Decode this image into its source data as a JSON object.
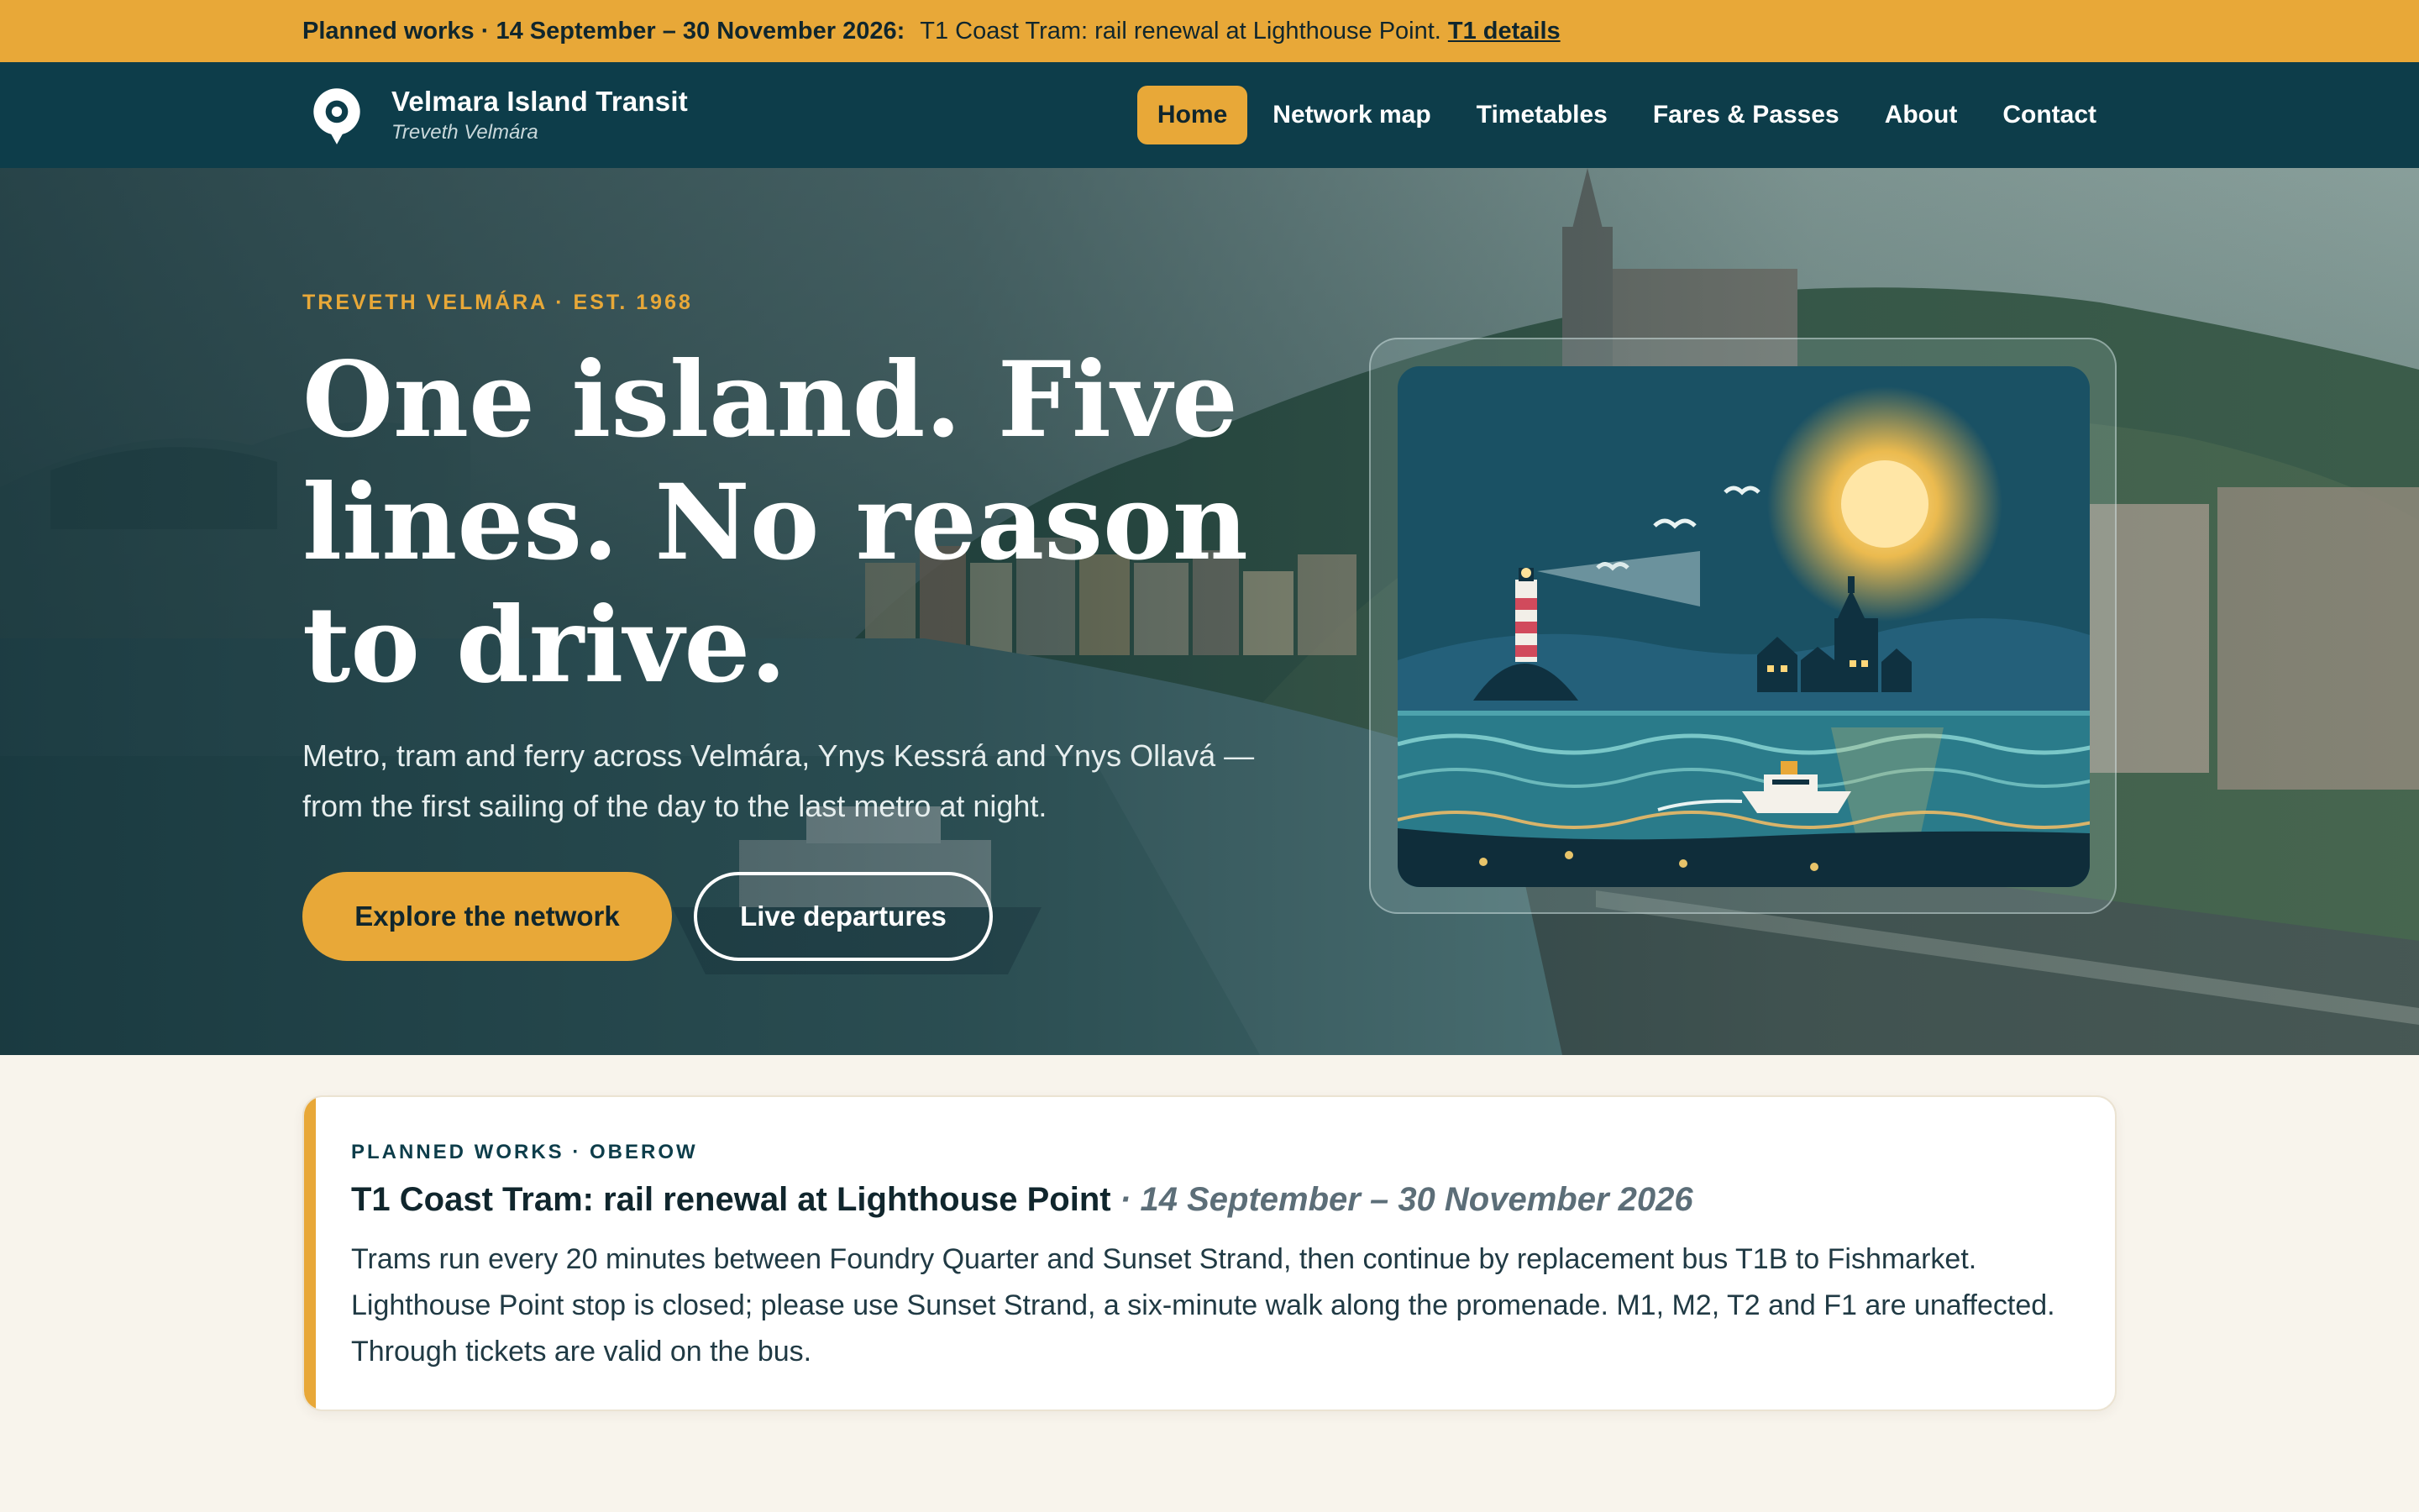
{
  "alert": {
    "label": "Planned works · 14 September – 30 November 2026:",
    "text": "T1 Coast Tram: rail renewal at Lighthouse Point.",
    "link": "T1 details"
  },
  "header": {
    "brand_name": "Velmara Island Transit",
    "brand_sub": "Treveth Velmára",
    "logo_icon": "location-pin-logo-icon",
    "nav": [
      {
        "label": "Home",
        "active": true
      },
      {
        "label": "Network map",
        "active": false
      },
      {
        "label": "Timetables",
        "active": false
      },
      {
        "label": "Fares & Passes",
        "active": false
      },
      {
        "label": "About",
        "active": false
      },
      {
        "label": "Contact",
        "active": false
      }
    ]
  },
  "hero": {
    "eyebrow": "TREVETH VELMÁRA · EST. 1968",
    "title": "One island. Five lines. No reason to drive.",
    "lede": "Metro, tram and ferry across Velmára, Ynys Kessrá and Ynys Ollavá — from the first sailing of the day to the last metro at night.",
    "primary_cta": "Explore the network",
    "secondary_cta": "Live departures",
    "illustration": "lighthouse-harbour-sun-ferry-illustration"
  },
  "notice": {
    "eyebrow": "PLANNED WORKS · OBEROW",
    "title": "T1 Coast Tram: rail renewal at Lighthouse Point",
    "dates": "· 14 September – 30 November 2026",
    "body": "Trams run every 20 minutes between Foundry Quarter and Sunset Strand, then continue by replacement bus T1B to Fishmarket. Lighthouse Point stop is closed; please use Sunset Strand, a six-minute walk along the promenade. M1, M2, T2 and F1 are unaffected. Through tickets are valid on the bus."
  },
  "colors": {
    "accent": "#e8a838",
    "header_bg": "#0d3d4a",
    "page_bg": "#f8f4ec",
    "text_dark": "#10262d"
  }
}
